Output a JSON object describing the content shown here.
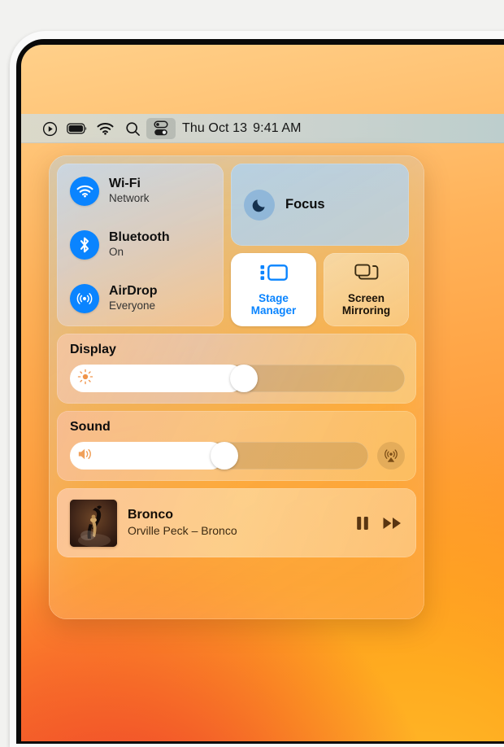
{
  "menu_bar": {
    "icons": [
      {
        "name": "play-circle-icon",
        "label": "Play"
      },
      {
        "name": "battery-icon",
        "label": "Battery"
      },
      {
        "name": "wifi-icon",
        "label": "Wi-Fi"
      },
      {
        "name": "search-icon",
        "label": "Spotlight Search"
      },
      {
        "name": "control-center-icon",
        "label": "Control Center"
      }
    ],
    "clock_date": "Thu Oct 13",
    "clock_time": "9:41 AM"
  },
  "control_center": {
    "connectivity": [
      {
        "icon": "wifi-icon",
        "title": "Wi-Fi",
        "subtitle": "Network"
      },
      {
        "icon": "bluetooth-icon",
        "title": "Bluetooth",
        "subtitle": "On"
      },
      {
        "icon": "airdrop-icon",
        "title": "AirDrop",
        "subtitle": "Everyone"
      }
    ],
    "focus": {
      "icon": "moon-icon",
      "label": "Focus"
    },
    "tiles": [
      {
        "icon": "stage-manager-icon",
        "label_line1": "Stage",
        "label_line2": "Manager",
        "active": true
      },
      {
        "icon": "screen-mirroring-icon",
        "label_line1": "Screen",
        "label_line2": "Mirroring",
        "active": false
      }
    ],
    "display": {
      "title": "Display",
      "icon": "brightness-sun-icon",
      "value": 52
    },
    "sound": {
      "title": "Sound",
      "icon": "speaker-wave-icon",
      "value": 52,
      "airplay_icon": "airplay-audio-icon"
    },
    "now_playing": {
      "artwork": "album-art-bronco",
      "title": "Bronco",
      "subtitle": "Orville Peck – Bronco",
      "pause_icon": "pause-icon",
      "forward_icon": "fast-forward-icon"
    }
  },
  "colors": {
    "accent_blue": "#0a84ff",
    "menubar_text": "#141414",
    "tile_active_bg": "#ffffff"
  }
}
